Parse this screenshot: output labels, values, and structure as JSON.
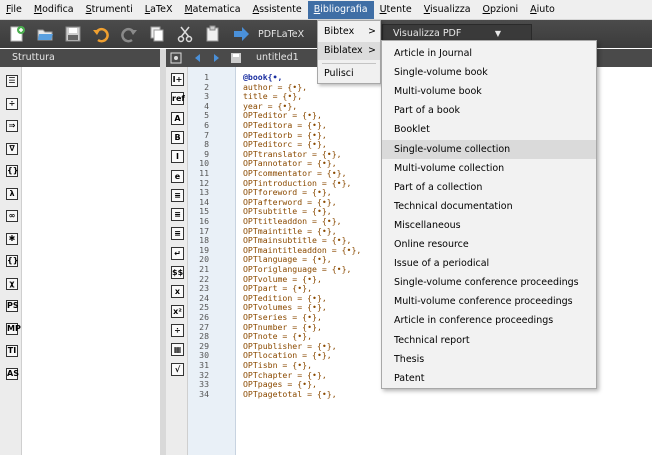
{
  "menubar": {
    "items": [
      {
        "label": "File",
        "ul": "F",
        "rest": "ile"
      },
      {
        "label": "Modifica",
        "ul": "M",
        "rest": "odifica"
      },
      {
        "label": "Strumenti",
        "ul": "S",
        "rest": "trumenti"
      },
      {
        "label": "LaTeX",
        "ul": "L",
        "rest": "aTeX"
      },
      {
        "label": "Matematica",
        "ul": "M",
        "rest": "atematica"
      },
      {
        "label": "Assistente",
        "ul": "A",
        "rest": "ssistente"
      },
      {
        "label": "Bibliografia",
        "ul": "B",
        "rest": "ibliografia"
      },
      {
        "label": "Utente",
        "ul": "U",
        "rest": "tente"
      },
      {
        "label": "Visualizza",
        "ul": "V",
        "rest": "isualizza"
      },
      {
        "label": "Opzioni",
        "ul": "O",
        "rest": "pzioni"
      },
      {
        "label": "Aiuto",
        "ul": "A",
        "rest": "iuto"
      }
    ]
  },
  "toolbar": {
    "compile_label": "PDFLaTeX",
    "view_label": "Visualizza PDF"
  },
  "structure": {
    "title": "Struttura"
  },
  "editor": {
    "tab_title": "untitled1",
    "lines": [
      "@book{•,",
      "author = {•},",
      "title = {•},",
      "year = {•},",
      "OPTeditor = {•},",
      "OPTeditora = {•},",
      "OPTeditorb = {•},",
      "OPTeditorc = {•},",
      "OPTtranslator = {•},",
      "OPTannotator = {•},",
      "OPTcommentator = {•},",
      "OPTintroduction = {•},",
      "OPTforeword = {•},",
      "OPTafterword = {•},",
      "OPTsubtitle = {•},",
      "OPTtitleaddon = {•},",
      "OPTmaintitle = {•},",
      "OPTmainsubtitle = {•},",
      "OPTmaintitleaddon = {•},",
      "OPTlanguage = {•},",
      "OPToriglanguage = {•},",
      "OPTvolume = {•},",
      "OPTpart = {•},",
      "OPTedition = {•},",
      "OPTvolumes = {•},",
      "OPTseries = {•},",
      "OPTnumber = {•},",
      "OPTnote = {•},",
      "OPTpublisher = {•},",
      "OPTlocation = {•},",
      "OPTisbn = {•},",
      "OPTchapter = {•},",
      "OPTpages = {•},",
      "OPTpagetotal = {•},"
    ]
  },
  "bib_menu": {
    "items": [
      "Bibtex",
      "Biblatex"
    ],
    "arrow": ">",
    "clear_label": "Pulisci"
  },
  "type_menu": {
    "items": [
      "Article in Journal",
      "Single-volume book",
      "Multi-volume book",
      "Part of a book",
      "Booklet",
      "Single-volume collection",
      "Multi-volume collection",
      "Part of a collection",
      "Technical documentation",
      "Miscellaneous",
      "Online resource",
      "Issue of a periodical",
      "Single-volume conference proceedings",
      "Multi-volume conference proceedings",
      "Article in conference proceedings",
      "Technical report",
      "Thesis",
      "Patent"
    ],
    "highlighted_index": 5
  },
  "structure_icons": [
    "list-icon",
    "fraction-icon",
    "arrow-icon",
    "nabla-icon",
    "braces-icon",
    "lambda-icon",
    "infinity-icon",
    "star-icon",
    "brace-group-icon",
    "chi-icon",
    "ps-icon",
    "mp-icon",
    "ti-icon",
    "as-icon"
  ],
  "structure_icon_glyphs": [
    "☰",
    "÷",
    "⇒",
    "∇",
    "{}",
    "λ",
    "∞",
    "✱",
    "{}",
    "χ",
    "PS",
    "MP",
    "TI",
    "AS"
  ],
  "editor_icons": [
    "layout-icon",
    "ref-icon",
    "accent-icon",
    "bold-icon",
    "italic-icon",
    "emph-icon",
    "align-left-icon",
    "align-center-icon",
    "align-right-icon",
    "newline-icon",
    "dollar-icon",
    "sub-icon",
    "sup-icon",
    "frac-icon",
    "sqrt-icon",
    "bracket-icon"
  ],
  "editor_icon_glyphs": [
    "I+",
    "ref",
    "A",
    "B",
    "I",
    "e",
    "≡",
    "≡",
    "≡",
    "↵",
    "$$",
    "x",
    "x²",
    "÷",
    "▦",
    "√"
  ]
}
